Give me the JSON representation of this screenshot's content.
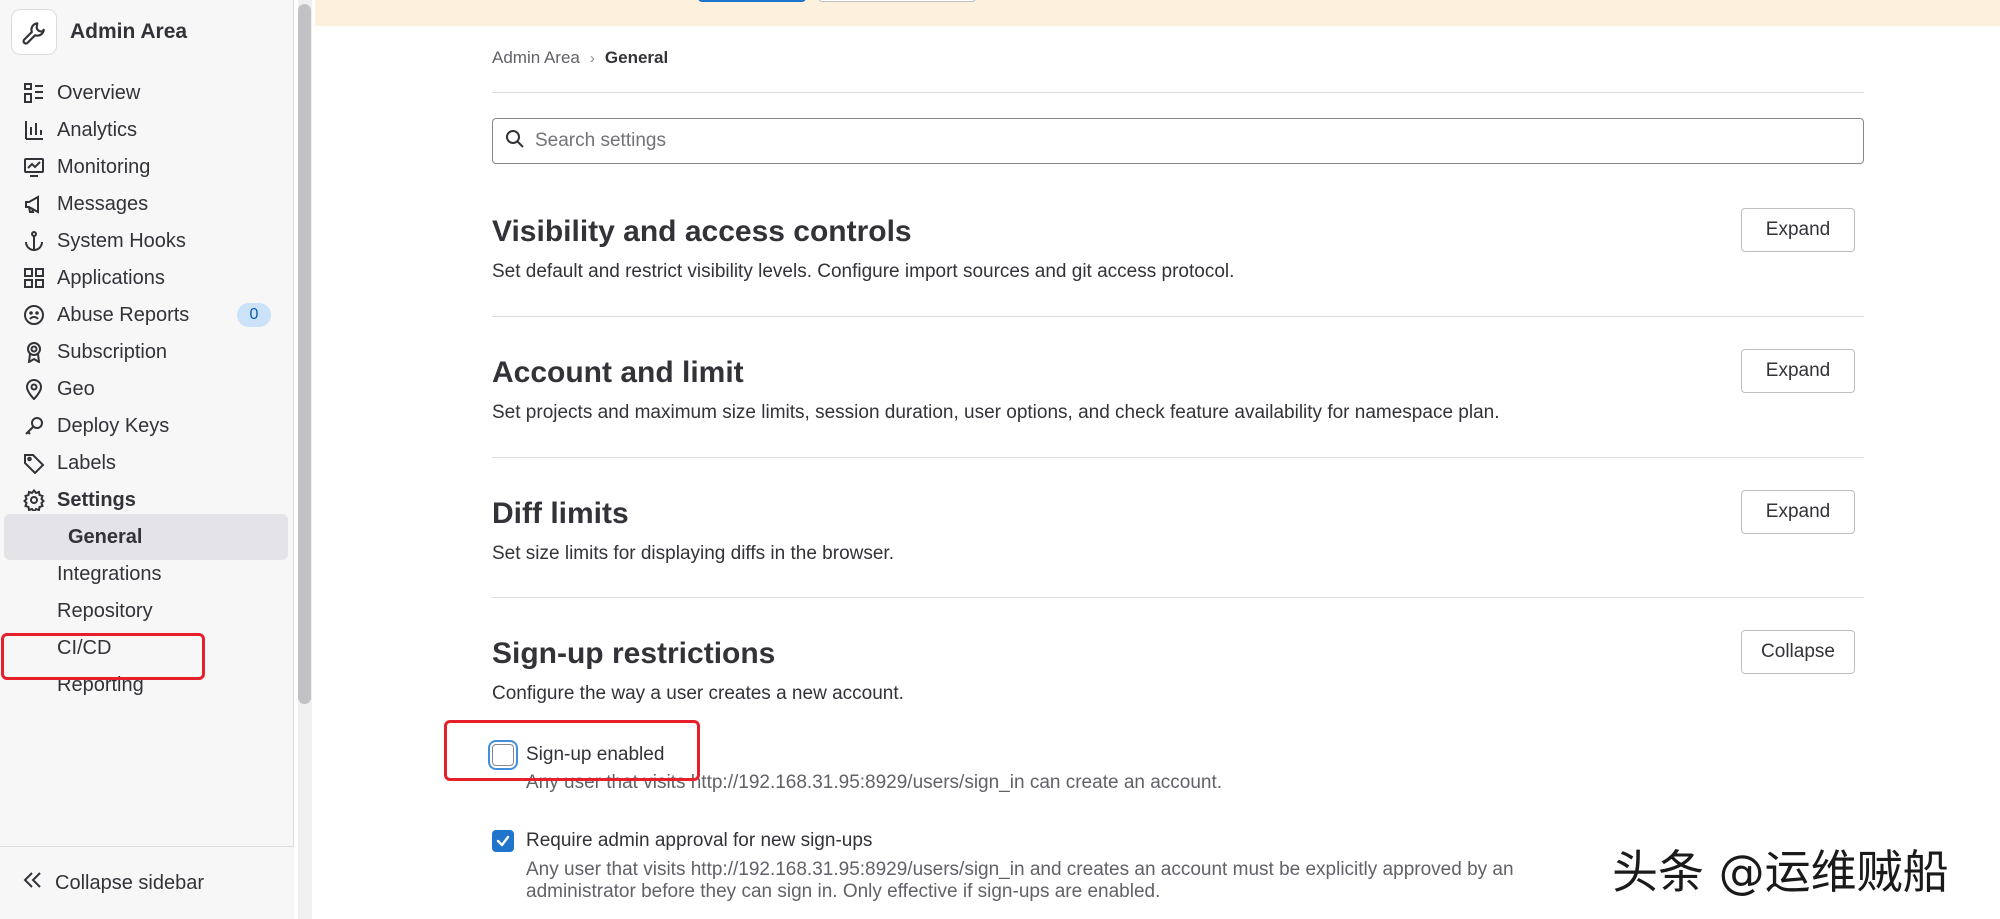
{
  "sidebar": {
    "title": "Admin Area",
    "items": [
      {
        "label": "Overview",
        "icon": "overview-icon"
      },
      {
        "label": "Analytics",
        "icon": "analytics-icon"
      },
      {
        "label": "Monitoring",
        "icon": "monitoring-icon"
      },
      {
        "label": "Messages",
        "icon": "megaphone-icon"
      },
      {
        "label": "System Hooks",
        "icon": "anchor-icon"
      },
      {
        "label": "Applications",
        "icon": "applications-icon"
      },
      {
        "label": "Abuse Reports",
        "icon": "abuse-icon",
        "badge": "0"
      },
      {
        "label": "Subscription",
        "icon": "subscription-icon"
      },
      {
        "label": "Geo",
        "icon": "location-icon"
      },
      {
        "label": "Deploy Keys",
        "icon": "key-icon"
      },
      {
        "label": "Labels",
        "icon": "label-icon"
      },
      {
        "label": "Settings",
        "icon": "settings-icon"
      }
    ],
    "settings_sub": [
      {
        "label": "General"
      },
      {
        "label": "Integrations"
      },
      {
        "label": "Repository"
      },
      {
        "label": "CI/CD"
      },
      {
        "label": "Reporting"
      }
    ],
    "collapse_label": "Collapse sidebar"
  },
  "breadcrumb": {
    "parent": "Admin Area",
    "current": "General"
  },
  "search": {
    "placeholder": "Search settings"
  },
  "sections": [
    {
      "title": "Visibility and access controls",
      "description": "Set default and restrict visibility levels. Configure import sources and git access protocol.",
      "button": "Expand"
    },
    {
      "title": "Account and limit",
      "description": "Set projects and maximum size limits, session duration, user options, and check feature availability for namespace plan.",
      "button": "Expand"
    },
    {
      "title": "Diff limits",
      "description": "Set size limits for displaying diffs in the browser.",
      "button": "Expand"
    },
    {
      "title": "Sign-up restrictions",
      "description": "Configure the way a user creates a new account.",
      "button": "Collapse"
    }
  ],
  "signup": {
    "signup_enabled": {
      "label": "Sign-up enabled",
      "checked": false,
      "help": "Any user that visits http://192.168.31.95:8929/users/sign_in can create an account."
    },
    "require_approval": {
      "label": "Require admin approval for new sign-ups",
      "checked": true,
      "help_line1": "Any user that visits http://192.168.31.95:8929/users/sign_in and creates an account must be explicitly approved by an",
      "help_line2": "administrator before they can sign in. Only effective if sign-ups are enabled."
    }
  },
  "watermark": "头条 @运维贼船",
  "colors": {
    "accent": "#1f75cb",
    "highlight": "#e5202a",
    "banner": "#fdf1dd"
  }
}
